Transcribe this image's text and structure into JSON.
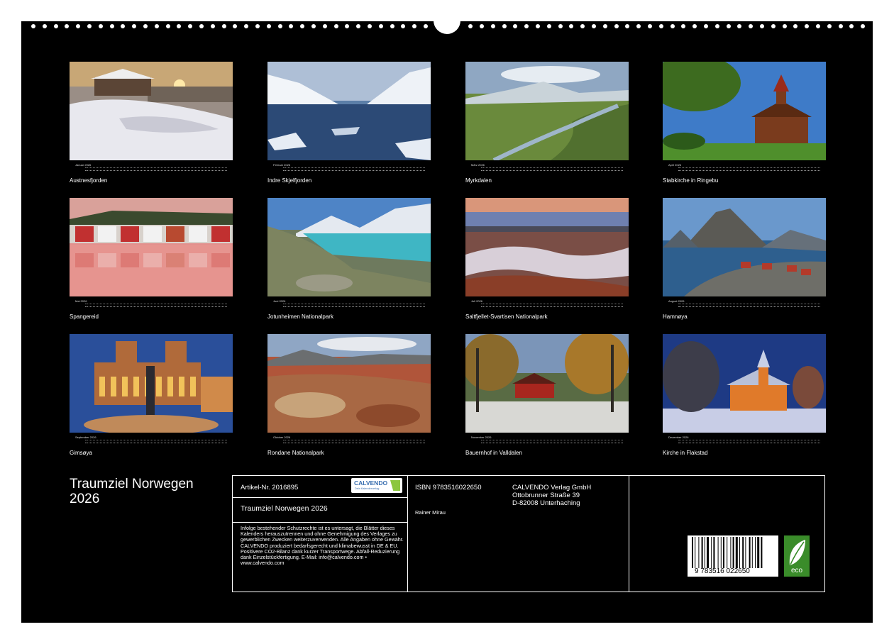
{
  "months": [
    {
      "month": "Januar 2026",
      "caption": "Austnesfjorden"
    },
    {
      "month": "Februar 2026",
      "caption": "Indre Skjelfjorden"
    },
    {
      "month": "März 2026",
      "caption": "Myrkdalen"
    },
    {
      "month": "April 2026",
      "caption": "Stabkirche in Ringebu"
    },
    {
      "month": "Mai 2026",
      "caption": "Spangereid"
    },
    {
      "month": "Juni 2026",
      "caption": "Jotunheimen Nationalpark"
    },
    {
      "month": "Juli 2026",
      "caption": "Saltfjellet-Svartisen Nationalpark"
    },
    {
      "month": "August 2026",
      "caption": "Hamnøya"
    },
    {
      "month": "September 2026",
      "caption": "Gimsøya"
    },
    {
      "month": "Oktober 2026",
      "caption": "Rondane Nationalpark"
    },
    {
      "month": "November 2026",
      "caption": "Bauernhof in Valldalen"
    },
    {
      "month": "Dezember 2026",
      "caption": "Kirche in Flakstad"
    }
  ],
  "title_line1": "Traumziel Norwegen",
  "title_line2": "2026",
  "info": {
    "article": "Artikel-Nr. 2016895",
    "calvendo_logo": "CALVENDO",
    "calvendo_tagline": "Dein Kalenderverlag",
    "title": "Traumziel Norwegen 2026",
    "legal": "Infolge bestehender Schutzrechte ist es untersagt, die Blätter dieses Kalenders herauszutrennen und ohne Genehmigung des Verlages zu gewerblichen Zwecken weiterzuverwenden. Alle Angaben ohne Gewähr. CALVENDO produziert bedarfsgerecht und klimabewusst in DE & EU. Positivere CO2-Bilanz dank kurzer Transportwege. Abfall-Reduzierung dank Einzelstückfertigung. E-Mail: info@calvendo.com • www.calvendo.com",
    "isbn": "ISBN 9783516022650",
    "author": "Rainer Mirau",
    "publisher_name": "CALVENDO Verlag GmbH",
    "publisher_street": "Ottobrunner Straße 39",
    "publisher_city": "D-82008 Unterhaching",
    "barcode_digits": "9 783516 022650",
    "eco_label": "eco"
  },
  "colors": {
    "background": "#000000",
    "text": "#ffffff",
    "eco_green": "#3a8c2a"
  }
}
